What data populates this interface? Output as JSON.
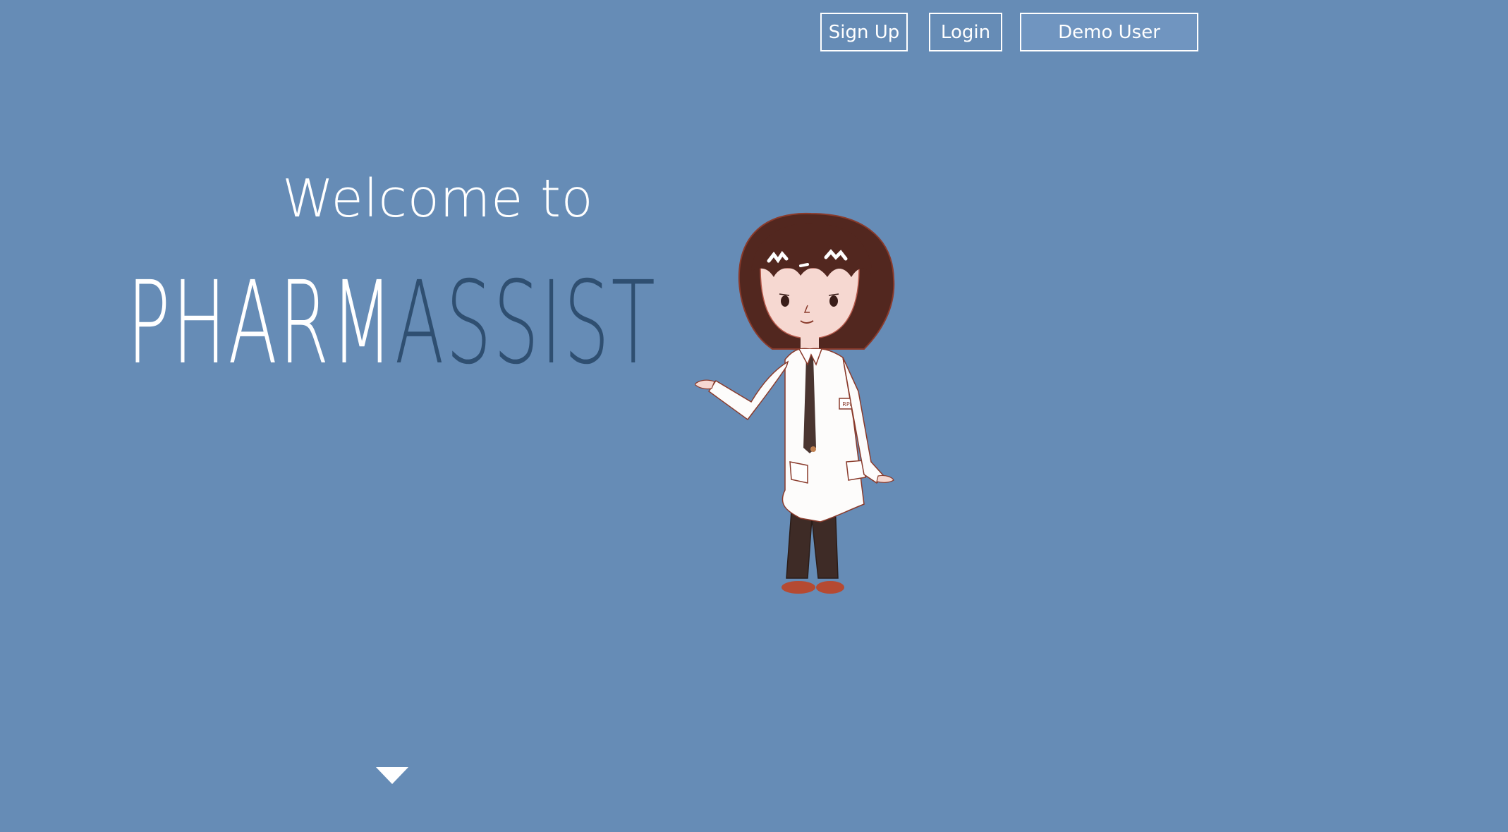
{
  "nav": {
    "signup_label": "Sign Up",
    "login_label": "Login",
    "demo_label": "Demo User"
  },
  "hero": {
    "welcome_text": "Welcome to",
    "brand_part1": "PHARM",
    "brand_part2": "ASSIST",
    "badge_text": "RPh"
  },
  "icons": {
    "scroll": "triangle-down-icon",
    "mascot": "pharmacist-illustration"
  },
  "colors": {
    "background": "#668cb6",
    "brand_accent": "#2f4f71",
    "text": "#ffffff"
  }
}
